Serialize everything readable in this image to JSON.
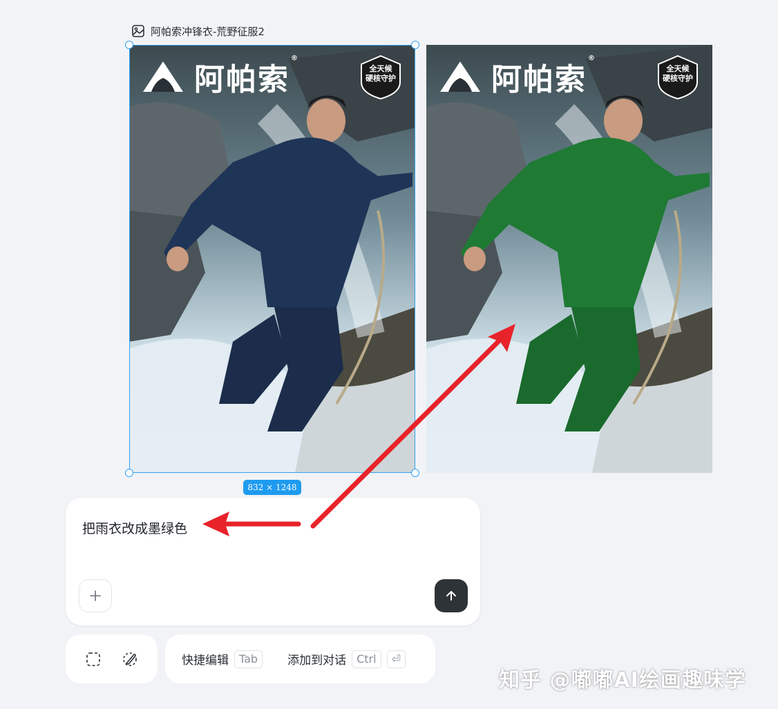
{
  "frame": {
    "title": "阿帕索冲锋衣-荒野征服2",
    "icon": "image-icon",
    "size_label": "832 × 1248"
  },
  "images": {
    "brand_name": "阿帕索",
    "registered_mark": "®",
    "badge_line1": "全天候",
    "badge_line2": "硬核守护",
    "original_jacket_color": "#1f3557",
    "edited_jacket_color": "#1f7a34"
  },
  "prompt": {
    "text": "把雨衣改成墨绿色",
    "add_icon": "plus-icon",
    "send_icon": "arrow-up-icon"
  },
  "toolbar": {
    "select_icon": "dashed-select-icon",
    "brush_icon": "brush-icon",
    "quick_edit_label": "快捷编辑",
    "quick_edit_key": "Tab",
    "add_to_chat_label": "添加到对话",
    "add_to_chat_key": "Ctrl",
    "enter_key": "⏎"
  },
  "annotation_color": "#e8232a",
  "accent_color": "#35a3f2",
  "watermark": "知乎 @嘟嘟AI绘画趣味学"
}
